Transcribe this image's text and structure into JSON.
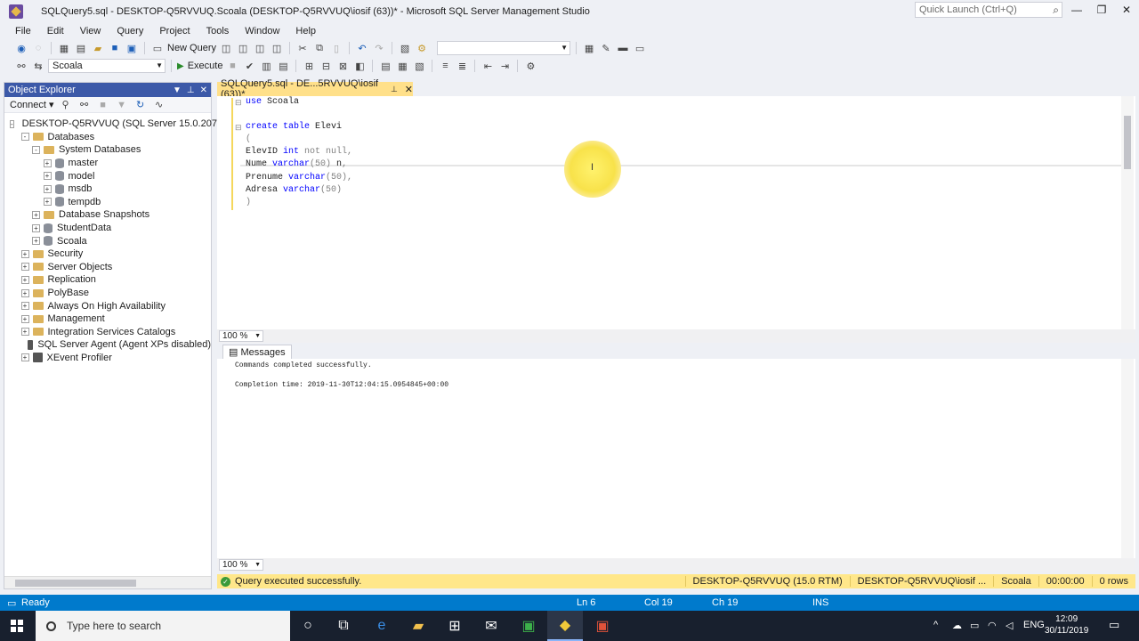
{
  "window": {
    "title": "SQLQuery5.sql - DESKTOP-Q5RVVUQ.Scoala (DESKTOP-Q5RVVUQ\\iosif (63))* - Microsoft SQL Server Management Studio",
    "quick_launch_placeholder": "Quick Launch (Ctrl+Q)"
  },
  "menu": [
    "File",
    "Edit",
    "View",
    "Query",
    "Project",
    "Tools",
    "Window",
    "Help"
  ],
  "toolbar": {
    "new_query": "New Query",
    "database": "Scoala",
    "execute": "Execute"
  },
  "object_explorer": {
    "title": "Object Explorer",
    "connect": "Connect",
    "tree": [
      {
        "label": "DESKTOP-Q5RVVUQ (SQL Server 15.0.2070.41",
        "level": 0,
        "kind": "server",
        "exp": "-"
      },
      {
        "label": "Databases",
        "level": 1,
        "kind": "folder",
        "exp": "-"
      },
      {
        "label": "System Databases",
        "level": 2,
        "kind": "folder",
        "exp": "-"
      },
      {
        "label": "master",
        "level": 3,
        "kind": "db",
        "exp": "+"
      },
      {
        "label": "model",
        "level": 3,
        "kind": "db",
        "exp": "+"
      },
      {
        "label": "msdb",
        "level": 3,
        "kind": "db",
        "exp": "+"
      },
      {
        "label": "tempdb",
        "level": 3,
        "kind": "db",
        "exp": "+"
      },
      {
        "label": "Database Snapshots",
        "level": 2,
        "kind": "folder",
        "exp": "+"
      },
      {
        "label": "StudentData",
        "level": 2,
        "kind": "db",
        "exp": "+"
      },
      {
        "label": "Scoala",
        "level": 2,
        "kind": "db",
        "exp": "+"
      },
      {
        "label": "Security",
        "level": 1,
        "kind": "folder",
        "exp": "+"
      },
      {
        "label": "Server Objects",
        "level": 1,
        "kind": "folder",
        "exp": "+"
      },
      {
        "label": "Replication",
        "level": 1,
        "kind": "folder",
        "exp": "+"
      },
      {
        "label": "PolyBase",
        "level": 1,
        "kind": "folder",
        "exp": "+"
      },
      {
        "label": "Always On High Availability",
        "level": 1,
        "kind": "folder",
        "exp": "+"
      },
      {
        "label": "Management",
        "level": 1,
        "kind": "folder",
        "exp": "+"
      },
      {
        "label": "Integration Services Catalogs",
        "level": 1,
        "kind": "folder",
        "exp": "+"
      },
      {
        "label": "SQL Server Agent (Agent XPs disabled)",
        "level": 1,
        "kind": "agent",
        "exp": ""
      },
      {
        "label": "XEvent Profiler",
        "level": 1,
        "kind": "agent",
        "exp": "+"
      }
    ]
  },
  "document_tab": {
    "label": "SQLQuery5.sql - DE...5RVVUQ\\iosif (63))*"
  },
  "editor": {
    "lines": [
      [
        {
          "t": "use ",
          "c": "kw"
        },
        {
          "t": "Scoala",
          "c": ""
        }
      ],
      [],
      [
        {
          "t": "create table ",
          "c": "kw"
        },
        {
          "t": "Elevi",
          "c": ""
        }
      ],
      [
        {
          "t": "(",
          "c": "gr"
        }
      ],
      [
        {
          "t": "ElevID ",
          "c": ""
        },
        {
          "t": "int ",
          "c": "ty"
        },
        {
          "t": "not null,",
          "c": "gr"
        }
      ],
      [
        {
          "t": "Nume ",
          "c": ""
        },
        {
          "t": "varchar",
          "c": "ty"
        },
        {
          "t": "(50) ",
          "c": "gr"
        },
        {
          "t": "n",
          "c": ""
        },
        {
          "t": ",",
          "c": "gr"
        }
      ],
      [
        {
          "t": "Prenume ",
          "c": ""
        },
        {
          "t": "varchar",
          "c": "ty"
        },
        {
          "t": "(50),",
          "c": "gr"
        }
      ],
      [
        {
          "t": "Adresa ",
          "c": ""
        },
        {
          "t": "varchar",
          "c": "ty"
        },
        {
          "t": "(50)",
          "c": "gr"
        }
      ],
      [
        {
          "t": ")",
          "c": "gr"
        }
      ]
    ]
  },
  "zoom": "100 %",
  "messages": {
    "tab": "Messages",
    "line1": "Commands completed successfully.",
    "line2": "Completion time: 2019-11-30T12:04:15.0954845+00:00"
  },
  "query_status": {
    "text": "Query executed successfully.",
    "server": "DESKTOP-Q5RVVUQ (15.0 RTM)",
    "user": "DESKTOP-Q5RVVUQ\\iosif ...",
    "database": "Scoala",
    "elapsed": "00:00:00",
    "rows": "0 rows"
  },
  "statusbar": {
    "ready": "Ready",
    "ln": "Ln 6",
    "col": "Col 19",
    "ch": "Ch 19",
    "mode": "INS"
  },
  "taskbar": {
    "search_placeholder": "Type here to search",
    "lang": "ENG",
    "time": "12:09",
    "date": "30/11/2019"
  }
}
